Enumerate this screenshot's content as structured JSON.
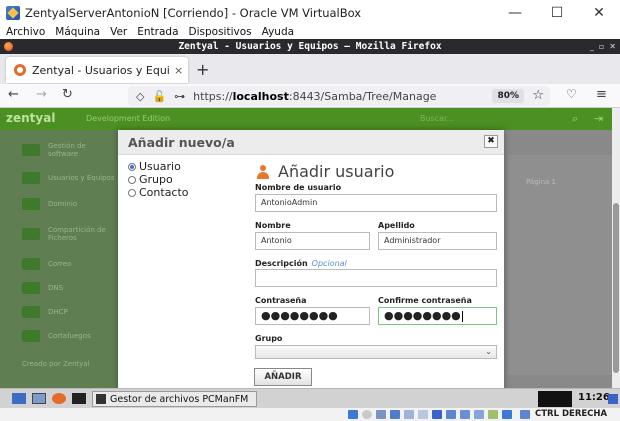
{
  "vbox": {
    "title": "ZentyalServerAntonioN [Corriendo] - Oracle VM VirtualBox",
    "menu": [
      "Archivo",
      "Máquina",
      "Ver",
      "Entrada",
      "Dispositivos",
      "Ayuda"
    ],
    "controls": {
      "minimize": "—",
      "maximize": "☐",
      "close": "✕"
    },
    "status_label": "CTRL DERECHA"
  },
  "firefox": {
    "title": "Zentyal - Usuarios y Equipos — Mozilla Firefox",
    "tab_label": "Zentyal - Usuarios y Equi",
    "tab_close": "×",
    "new_tab": "+",
    "url_prefix": "https://",
    "url_host": "localhost",
    "url_rest": ":8443/Samba/Tree/Manage",
    "zoom": "80%"
  },
  "zentyal": {
    "logo": "zentyal",
    "logo_sub": "Development Edition",
    "search": "Buscar...",
    "page_label": "Página 1",
    "sidebar": [
      {
        "label": "Gestión de software"
      },
      {
        "label": "Usuarios y Equipos"
      },
      {
        "label": "Dominio"
      },
      {
        "label": "Compartición de Ficheros"
      },
      {
        "label": "Correo"
      },
      {
        "label": "DNS"
      },
      {
        "label": "DHCP"
      },
      {
        "label": "Cortafuegos"
      },
      {
        "label": "Creado por Zentyal"
      }
    ]
  },
  "modal": {
    "title": "Añadir nuevo/a",
    "close": "✖",
    "types": [
      {
        "label": "Usuario",
        "selected": true
      },
      {
        "label": "Grupo",
        "selected": false
      },
      {
        "label": "Contacto",
        "selected": false
      }
    ],
    "form_title": "Añadir usuario",
    "username_label": "Nombre de usuario",
    "username_value": "AntonioAdmin",
    "firstname_label": "Nombre",
    "firstname_value": "Antonio",
    "lastname_label": "Apellido",
    "lastname_value": "Administrador",
    "description_label": "Descripción",
    "optional": "Opcional",
    "description_value": "",
    "password_label": "Contraseña",
    "password_value": "●●●●●●●●",
    "confirm_label": "Confirme contraseña",
    "confirm_value": "●●●●●●●●",
    "group_label": "Grupo",
    "group_value": "",
    "submit": "AÑADIR"
  },
  "taskbar": {
    "task_label": "Gestor de archivos PCManFM",
    "clock": "11:26"
  }
}
